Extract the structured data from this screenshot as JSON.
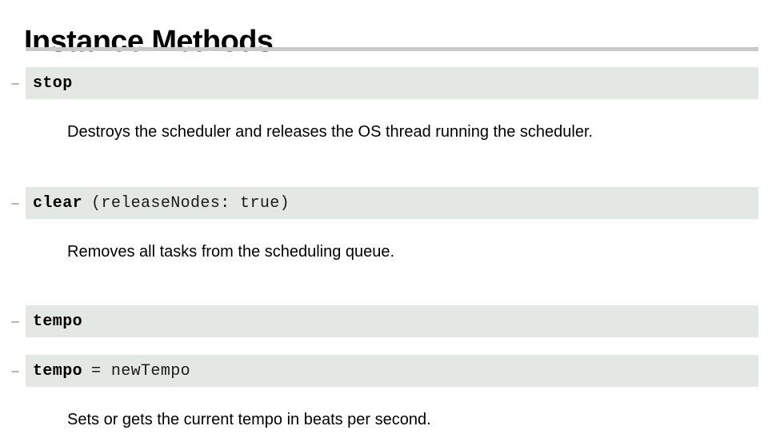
{
  "page": {
    "title": "Instance Methods",
    "dash_glyph": "–"
  },
  "colors": {
    "signature_band_background": "#e4e8e4",
    "title_rule": "#c9c9c9",
    "text": "#000000",
    "dash": "#808080",
    "page_background": "#ffffff"
  },
  "methods": [
    {
      "name": "stop",
      "args": "",
      "description": "Destroys the scheduler and releases the OS thread running the scheduler."
    },
    {
      "name": "clear",
      "args": "(releaseNodes: true)",
      "description": "Removes all tasks from the scheduling queue."
    },
    {
      "name": "tempo",
      "args": "",
      "description": ""
    },
    {
      "name": "tempo",
      "args": "= newTempo",
      "description": "Sets or gets the current tempo in beats per second."
    }
  ]
}
